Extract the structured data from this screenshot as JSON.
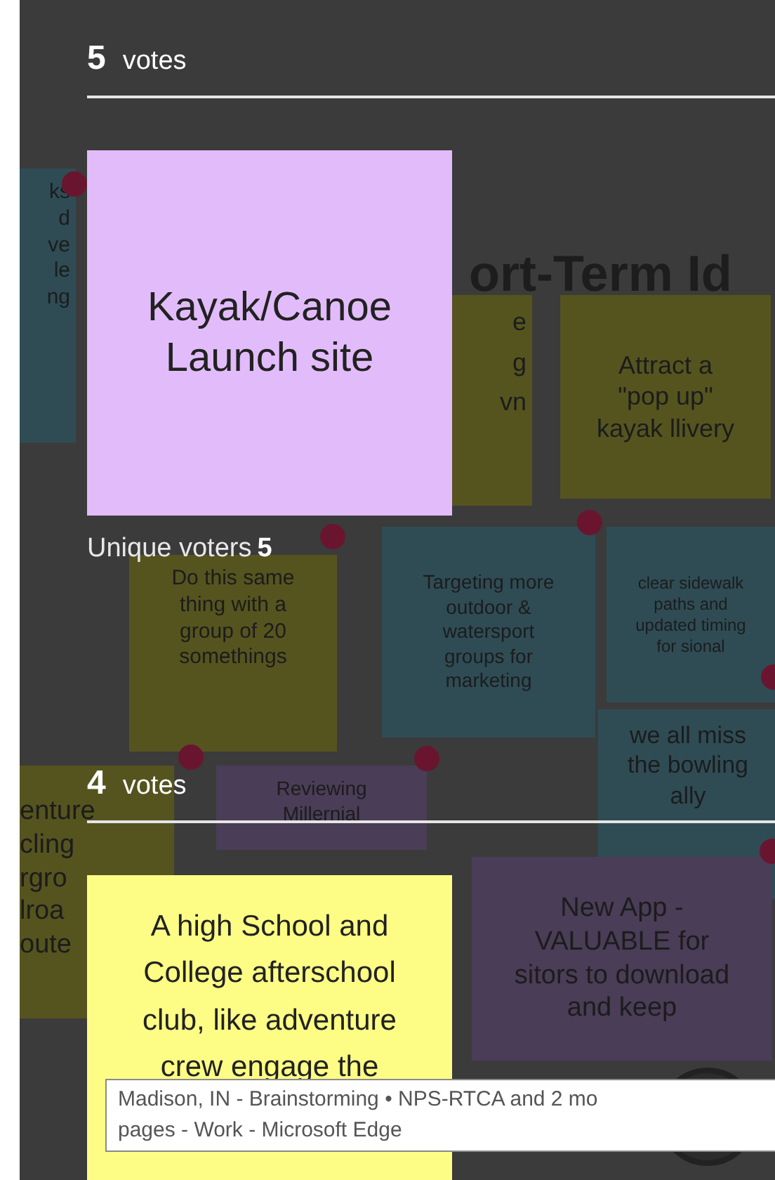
{
  "board": {
    "heading": "ort-Term Id",
    "notes": [
      {
        "color": "#2f4c55",
        "lines": [
          "ks",
          "d",
          "ve",
          "le",
          "ng"
        ]
      },
      {
        "color": "#55541f",
        "lines": [
          "e",
          "g",
          "vn"
        ]
      },
      {
        "color": "#55541f",
        "lines": [
          "Attract a",
          "\"pop up\"",
          "kayak llivery"
        ]
      },
      {
        "color": "#55541f",
        "lines": [
          "Do this same",
          "thing with a",
          "group of 20",
          "somethings"
        ]
      },
      {
        "color": "#2f4c55",
        "lines": [
          "Targeting more",
          "outdoor &",
          "watersport",
          "groups for",
          "marketing"
        ]
      },
      {
        "color": "#2f4c55",
        "lines": [
          "clear sidewalk",
          "paths and",
          "updated timing",
          "for sional"
        ]
      },
      {
        "color": "#2f4c55",
        "lines": [
          "we all miss",
          "the bowling",
          "ally"
        ]
      },
      {
        "color": "#55541f",
        "lines": [
          "enture",
          "cling",
          "rgro",
          "lroa",
          "oute"
        ]
      },
      {
        "color": "#4a3d57",
        "lines": [
          "Reviewing",
          "Millernial"
        ]
      },
      {
        "color": "#4a3d57",
        "lines": [
          "New App -",
          "VALUABLE for",
          "sitors to download",
          "and keep"
        ]
      }
    ]
  },
  "results": [
    {
      "count": "5",
      "unit": "votes",
      "color": "#e2bcfa",
      "card_text": "Kayak/Canoe Launch site",
      "voters_label": "Unique voters",
      "voters": "5"
    },
    {
      "count": "4",
      "unit": "votes",
      "color": "#fdfd86",
      "card_text": "A high School and College afterschool club, like adventure crew    engage the"
    }
  ],
  "tooltip": {
    "lines": [
      "Madison, IN - Brainstorming • NPS-RTCA and 2 mo",
      "pages - Work - Microsoft Edge"
    ]
  }
}
